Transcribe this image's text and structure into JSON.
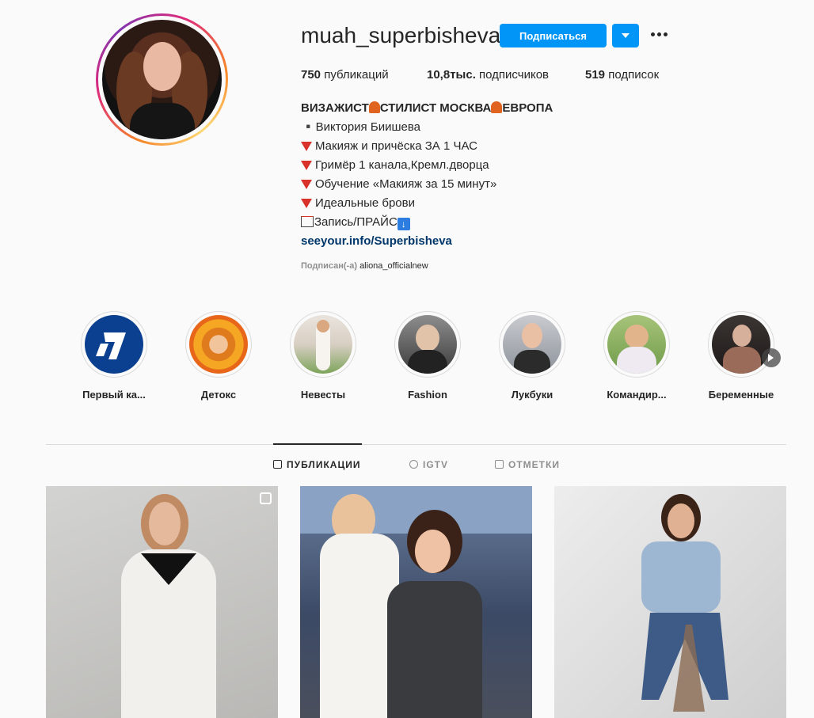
{
  "profile": {
    "username": "muah_superbisheva",
    "follow_label": "Подписаться",
    "stats": {
      "posts_count": "750",
      "posts_label": "публикаций",
      "followers_count": "10,8тыс.",
      "followers_label": "подписчиков",
      "following_count": "519",
      "following_label": "подписок"
    },
    "bio": {
      "line1_a": "ВИЗАЖИСТ",
      "line1_b": "СТИЛИСТ МОСКВА",
      "line1_c": "ЕВРОПА",
      "line2": "▪️Виктория Биишева",
      "line3": "Макияж и причёска ЗА 1 ЧАС",
      "line4": "Гримёр 1 канала,Кремл.дворца",
      "line5": "Обучение «Макияж за 15 минут»",
      "line6": "Идеальные брови",
      "line7": "Запись/ПРАЙС",
      "link": "seeyour.info/Superbisheva"
    },
    "followed_by_prefix": "Подписан(-а)",
    "followed_by_user": "aliona_officialnew"
  },
  "highlights": [
    {
      "label": "Первый ка..."
    },
    {
      "label": "Детокс"
    },
    {
      "label": "Невесты"
    },
    {
      "label": "Fashion"
    },
    {
      "label": "Лукбуки"
    },
    {
      "label": "Командир..."
    },
    {
      "label": "Беременные"
    }
  ],
  "tabs": [
    {
      "label": "ПУБЛИКАЦИИ",
      "icon": "grid-icon"
    },
    {
      "label": "IGTV",
      "icon": "igtv-icon"
    },
    {
      "label": "ОТМЕТКИ",
      "icon": "tagged-icon"
    }
  ],
  "colors": {
    "accent": "#0095f6",
    "link": "#00376b",
    "background": "#fafafa"
  }
}
